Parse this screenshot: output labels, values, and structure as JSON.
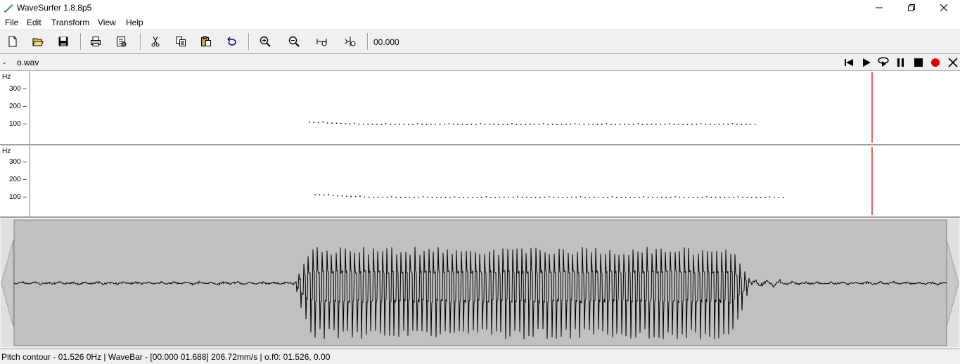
{
  "window": {
    "title": "WaveSurfer 1.8.8p5",
    "minimize_icon": "minimize-icon",
    "maximize_icon": "restore-icon",
    "close_icon": "close-icon"
  },
  "menu": [
    "File",
    "Edit",
    "Transform",
    "View",
    "Help"
  ],
  "toolbar": {
    "buttons": [
      "new-file",
      "open-file",
      "save",
      "print",
      "properties",
      "cut",
      "copy",
      "paste",
      "undo",
      "zoom-in",
      "zoom-out",
      "zoom-fit",
      "zoom-selection"
    ],
    "time": "00.000"
  },
  "file": {
    "dash": "-",
    "name": "o.wav",
    "controls": [
      "skip-to-start",
      "play",
      "play-loop",
      "pause",
      "stop",
      "record",
      "close"
    ]
  },
  "pitch_panes": [
    {
      "unit": "Hz",
      "ticks": [
        "300",
        "200",
        "100"
      ]
    },
    {
      "unit": "Hz",
      "ticks": [
        "300",
        "200",
        "100"
      ]
    }
  ],
  "colors": {
    "cursor": "#c00000",
    "record": "#e00000",
    "wave_bg": "#c0c0c0",
    "wave_line": "#000000"
  },
  "status": {
    "text": "Pitch contour - 01.526 0Hz  | WaveBar - [00.000 01.688] 206.72mm/s | o.f0: 01.526, 0.00"
  }
}
